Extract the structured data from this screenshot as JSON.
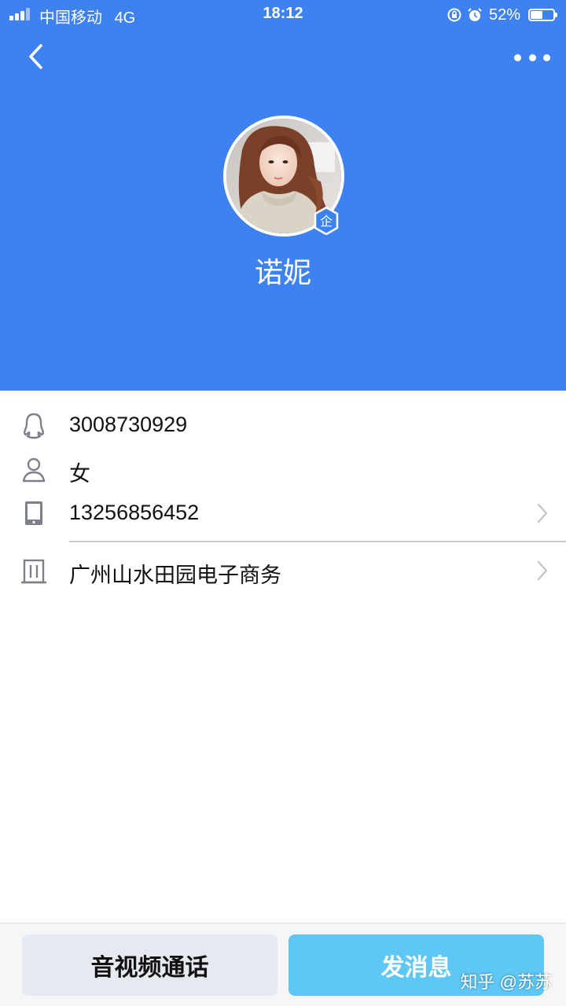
{
  "status_bar": {
    "carrier": "中国移动",
    "network": "4G",
    "time": "18:12",
    "battery_percent": "52%",
    "battery_level": 0.52,
    "icons": [
      "signal-icon",
      "rotation-lock-icon",
      "alarm-icon",
      "battery-icon"
    ]
  },
  "nav": {
    "back_icon": "chevron-left-icon",
    "more_icon": "more-dots-icon"
  },
  "profile": {
    "name": "诺妮",
    "badge_label": "企",
    "header_color": "#3e82f1"
  },
  "info": {
    "qq": "3008730929",
    "gender": "女",
    "phone": "13256856452",
    "company": "广州山水田园电子商务"
  },
  "actions": {
    "call_label": "音视频通话",
    "message_label": "发消息",
    "message_color": "#5ec7f5"
  },
  "watermark": "知乎 @苏苏"
}
